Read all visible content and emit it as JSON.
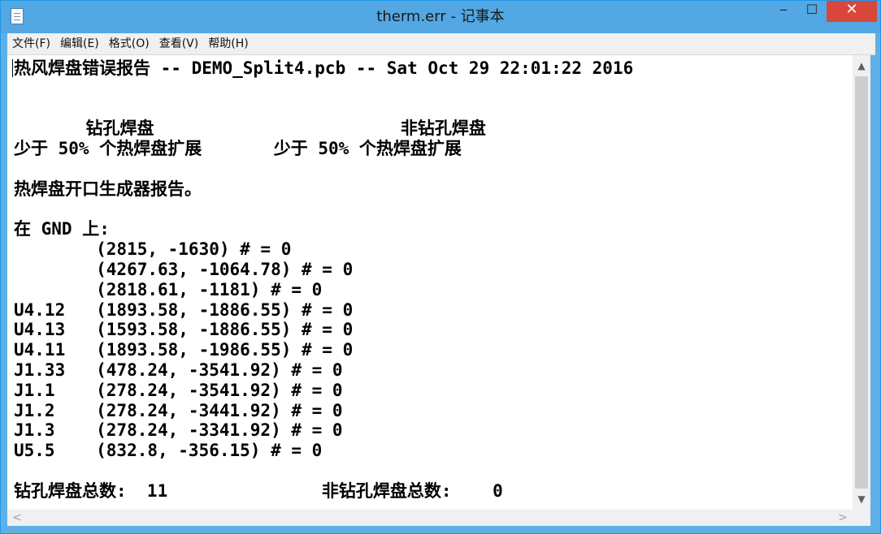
{
  "window": {
    "title": "therm.err - 记事本",
    "icon": "notepad-icon",
    "controls": {
      "minimize": "‒",
      "maximize": "☐",
      "close": "✕"
    }
  },
  "menu": [
    "文件(F)",
    "编辑(E)",
    "格式(O)",
    "查看(V)",
    "帮助(H)"
  ],
  "document": {
    "lines": [
      "热风焊盘错误报告 -- DEMO_Split4.pcb -- Sat Oct 29 22:01:22 2016",
      "",
      "",
      "       钻孔焊盘                        非钻孔焊盘",
      "少于 50% 个热焊盘扩展       少于 50% 个热焊盘扩展",
      "",
      "热焊盘开口生成器报告。",
      "",
      "在 GND 上:",
      "        (2815, -1630) # = 0",
      "        (4267.63, -1064.78) # = 0",
      "        (2818.61, -1181) # = 0",
      "U4.12   (1893.58, -1886.55) # = 0",
      "U4.13   (1593.58, -1886.55) # = 0",
      "U4.11   (1893.58, -1986.55) # = 0",
      "J1.33   (478.24, -3541.92) # = 0",
      "J1.1    (278.24, -3541.92) # = 0",
      "J1.2    (278.24, -3441.92) # = 0",
      "J1.3    (278.24, -3341.92) # = 0",
      "U5.5    (832.8, -356.15) # = 0",
      "",
      "钻孔焊盘总数:  11               非钻孔焊盘总数:    0"
    ]
  },
  "scrollbar": {
    "up": "▲",
    "down": "▼",
    "left": "<",
    "right": ">"
  }
}
